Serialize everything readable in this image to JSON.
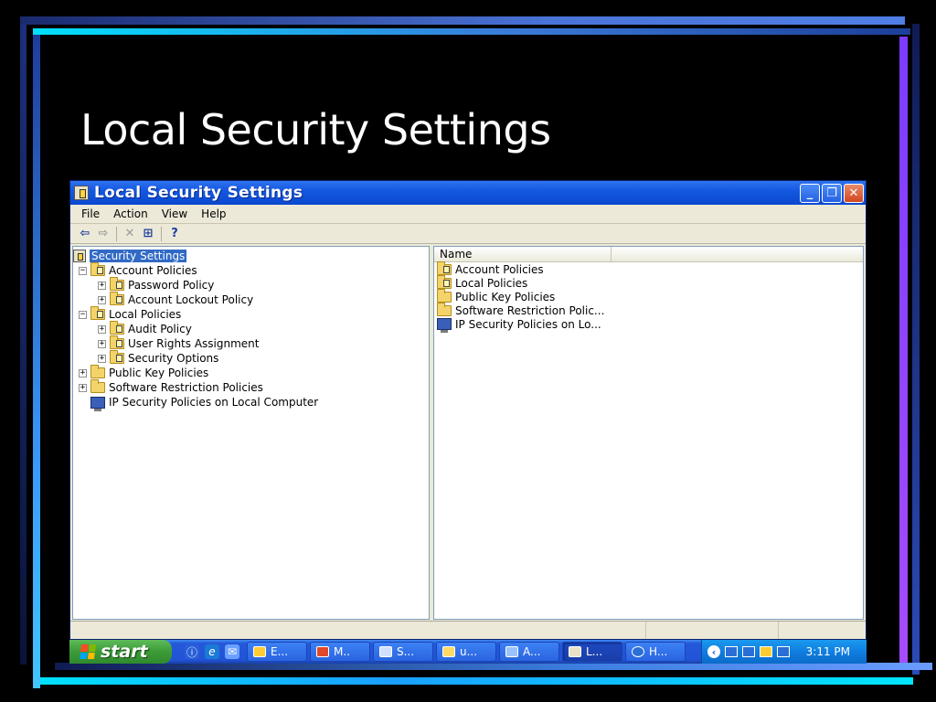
{
  "slide": {
    "title": "Local Security Settings"
  },
  "window": {
    "title": "Local Security Settings",
    "controls": {
      "minimize": "_",
      "maximize": "❐",
      "close": "✕"
    }
  },
  "menu": [
    "File",
    "Action",
    "View",
    "Help"
  ],
  "toolbar": {
    "back": "⇦",
    "forward": "⇨",
    "delete": "✕",
    "export": "⊞",
    "help": "?"
  },
  "tree": {
    "root": "Security Settings",
    "items": [
      {
        "label": "Account Policies",
        "expander": "−",
        "icon": "secure-folder-icon"
      },
      {
        "label": "Password Policy",
        "expander": "+",
        "icon": "secure-folder-icon"
      },
      {
        "label": "Account Lockout Policy",
        "expander": "+",
        "icon": "secure-folder-icon"
      },
      {
        "label": "Local Policies",
        "expander": "−",
        "icon": "secure-folder-icon"
      },
      {
        "label": "Audit Policy",
        "expander": "+",
        "icon": "secure-folder-icon"
      },
      {
        "label": "User Rights Assignment",
        "expander": "+",
        "icon": "secure-folder-icon"
      },
      {
        "label": "Security Options",
        "expander": "+",
        "icon": "secure-folder-icon"
      },
      {
        "label": "Public Key Policies",
        "expander": "+",
        "icon": "folder-icon"
      },
      {
        "label": "Software Restriction Policies",
        "expander": "+",
        "icon": "folder-icon"
      },
      {
        "label": "IP Security Policies on Local Computer",
        "expander": "",
        "icon": "computer-icon"
      }
    ]
  },
  "list": {
    "column": "Name",
    "rows": [
      {
        "label": "Account Policies",
        "icon": "secure-folder-icon"
      },
      {
        "label": "Local Policies",
        "icon": "secure-folder-icon"
      },
      {
        "label": "Public Key Policies",
        "icon": "folder-icon"
      },
      {
        "label": "Software Restriction Polic...",
        "icon": "folder-icon"
      },
      {
        "label": "IP Security Policies on Lo...",
        "icon": "computer-icon"
      }
    ]
  },
  "taskbar": {
    "start": "start",
    "quicklaunch": [
      "ⓘ",
      "e",
      "✉"
    ],
    "tasks": [
      "E...",
      "M..",
      "S...",
      "u...",
      "A...",
      "L...",
      "H..."
    ],
    "active_task": 5,
    "tray_chevron": "‹",
    "clock": "3:11 PM"
  },
  "colors": {
    "selection": "#316ac5",
    "titlebar": "#0a48cf",
    "taskbar": "#2153d6",
    "start": "#3d9a37"
  }
}
